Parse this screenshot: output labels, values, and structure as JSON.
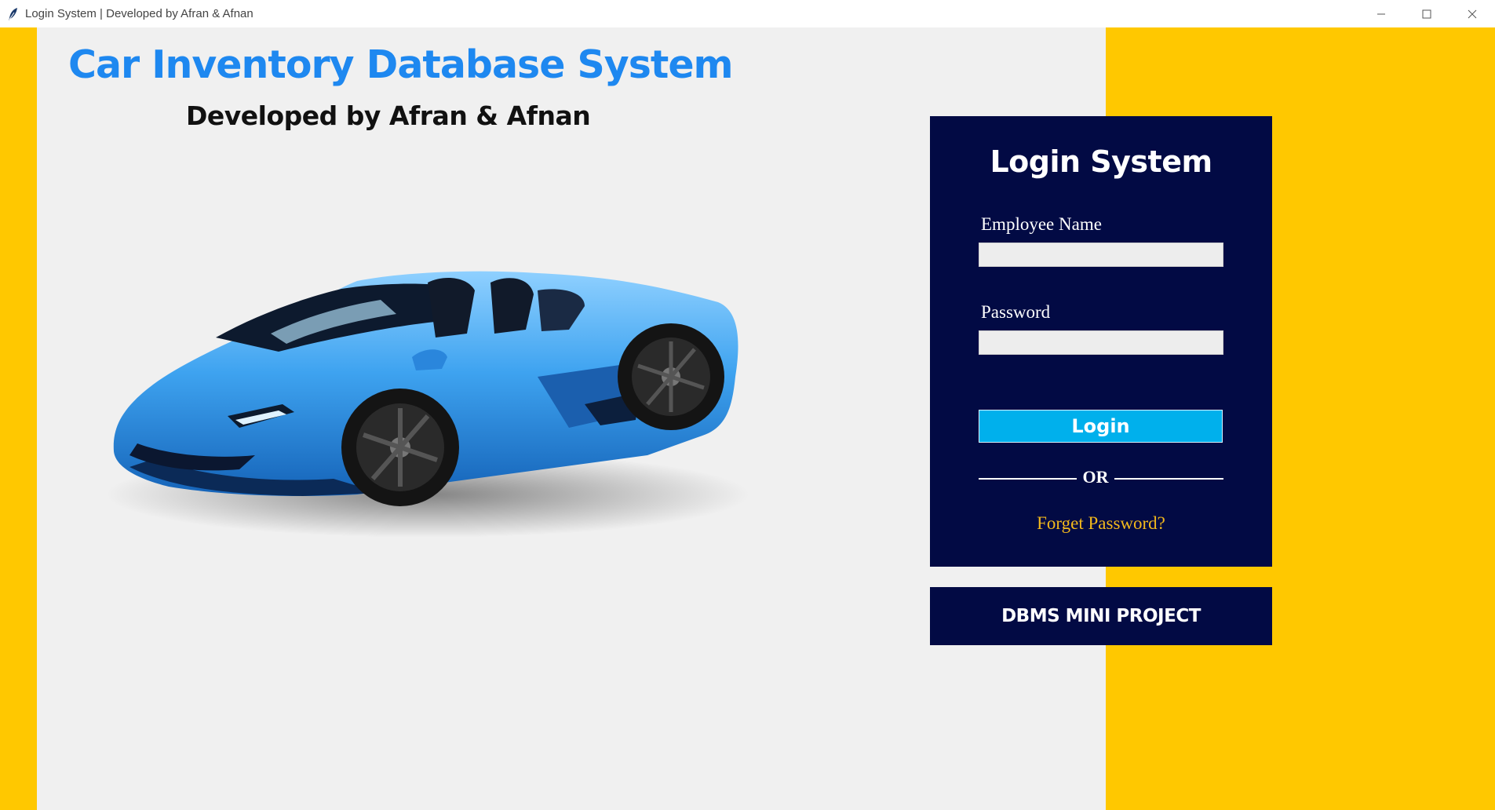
{
  "window": {
    "title": "Login System | Developed by Afran & Afnan",
    "minimize_label": "–",
    "maximize_label": "□",
    "close_label": "✕"
  },
  "header": {
    "title": "Car Inventory Database System",
    "subtitle": "Developed by Afran & Afnan"
  },
  "login": {
    "title": "Login System",
    "employee_label": "Employee Name",
    "employee_value": "",
    "password_label": "Password",
    "password_value": "",
    "login_button": "Login",
    "or_text": "OR",
    "forget_password": "Forget Password?"
  },
  "footer": {
    "project_label": "DBMS MINI PROJECT"
  },
  "colors": {
    "accent_yellow": "#ffc800",
    "panel_navy": "#020a44",
    "title_blue": "#1e88f0",
    "button_cyan": "#00b0ec",
    "link_gold": "#f2b81c"
  }
}
